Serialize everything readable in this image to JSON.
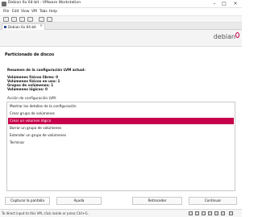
{
  "window": {
    "title": "Debian 6x 64-bit - VMware Workstation"
  },
  "menu": {
    "items": [
      "File",
      "Edit",
      "View",
      "VM",
      "Tabs",
      "Help"
    ]
  },
  "tab": {
    "label": "Debian 6x 64-bit"
  },
  "installer": {
    "logo_text": "debian",
    "page_title": "Particionado de discos",
    "summary_heading": "Resumen de la configuración LVM actual:",
    "summary_lines": [
      "Volúmenes físicos libres:  0",
      "Volúmenes físicos en uso:  1",
      "Grupos de volúmenes:        1",
      "Volúmenes lógicos:          0"
    ],
    "action_label": "Acción de configuración LVM:",
    "options": [
      "Mostrar los detalles de la configuración",
      "Crear grupo de volúmenes",
      "Crear un volumen lógico",
      "Borrar un grupo de volúmenes",
      "Extender un grupo de volúmenes",
      "Terminar"
    ],
    "selected_index": 2
  },
  "buttons": {
    "screenshot": "Capturar la pantalla",
    "help": "Ayuda",
    "back": "Retroceder",
    "continue": "Continuar"
  },
  "status": {
    "text": "To direct input to this VM, click inside or press Ctrl+G."
  },
  "colors": {
    "accent": "#c7004c"
  }
}
